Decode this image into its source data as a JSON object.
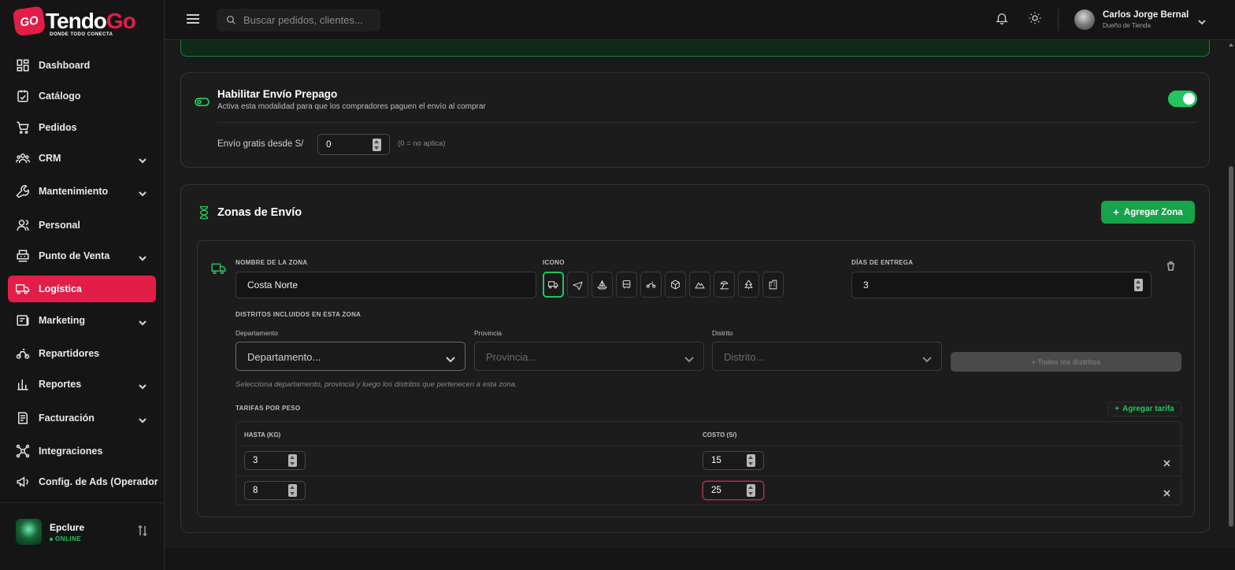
{
  "brand": {
    "name_part1": "Tendo",
    "name_part2": "Go",
    "badge": "GO",
    "tagline": "DONDE TODO CONECTA"
  },
  "sidebar": {
    "items": [
      {
        "label": "Dashboard",
        "icon": "dashboard-icon",
        "has_children": false
      },
      {
        "label": "Catálogo",
        "icon": "catalog-icon",
        "has_children": false
      },
      {
        "label": "Pedidos",
        "icon": "cart-icon",
        "has_children": false
      },
      {
        "label": "CRM",
        "icon": "users-icon",
        "has_children": true
      },
      {
        "label": "Mantenimiento",
        "icon": "wrench-icon",
        "has_children": true
      },
      {
        "label": "Personal",
        "icon": "person-icon",
        "has_children": false
      },
      {
        "label": "Punto de Venta",
        "icon": "pos-icon",
        "has_children": true
      },
      {
        "label": "Logística",
        "icon": "truck-icon",
        "has_children": false,
        "active": true
      },
      {
        "label": "Marketing",
        "icon": "marketing-icon",
        "has_children": true
      },
      {
        "label": "Repartidores",
        "icon": "delivery-icon",
        "has_children": false
      },
      {
        "label": "Reportes",
        "icon": "bar-chart-icon",
        "has_children": true
      },
      {
        "label": "Facturación",
        "icon": "invoice-icon",
        "has_children": true
      },
      {
        "label": "Integraciones",
        "icon": "integrations-icon",
        "has_children": false
      },
      {
        "label": "Config. de Ads (Operador",
        "icon": "megaphone-icon",
        "has_children": false
      }
    ],
    "store": {
      "name": "Epclure",
      "status": "ONLINE"
    }
  },
  "header": {
    "search_placeholder": "Buscar pedidos, clientes...",
    "user_name": "Carlos Jorge Bernal",
    "user_role": "Dueño de Tienda"
  },
  "prepaid": {
    "title": "Habilitar Envío Prepago",
    "subtitle": "Activa esta modalidad para que los compradores paguen el envío al comprar",
    "enabled": true,
    "free_label": "Envío gratis desde S/",
    "free_value": "0",
    "free_note": "(0 = no aplica)"
  },
  "zones": {
    "title": "Zonas de Envío",
    "add_zone_label": "Agregar Zona",
    "zone": {
      "name_label": "NOMBRE DE LA ZONA",
      "name_value": "Costa Norte",
      "icon_label": "ICONO",
      "icons": [
        "truck-icon",
        "plane-icon",
        "ship-icon",
        "bus-icon",
        "motorcycle-icon",
        "box-icon",
        "mountain-icon",
        "beach-icon",
        "tree-icon",
        "building-icon"
      ],
      "selected_icon": 0,
      "days_label": "DÍAS DE ENTREGA",
      "days_value": "3",
      "districts_label": "DISTRITOS INCLUIDOS EN ESTA ZONA",
      "dept_label": "Departamento",
      "dept_placeholder": "Departamento...",
      "prov_label": "Provincia",
      "prov_placeholder": "Provincia...",
      "dist_label": "Distrito",
      "dist_placeholder": "Distrito...",
      "all_districts_label": "+ Todos los distritos",
      "hint": "Selecciona departamento, provincia y luego los distritos que pertenecen a esta zona.",
      "rates_label": "TARIFAS POR PESO",
      "add_rate_label": "Agregar tarifa",
      "rates_headers": [
        "HASTA (KG)",
        "COSTO (S/)"
      ],
      "rates": [
        {
          "kg": "3",
          "cost": "15"
        },
        {
          "kg": "8",
          "cost": "25"
        }
      ]
    }
  }
}
